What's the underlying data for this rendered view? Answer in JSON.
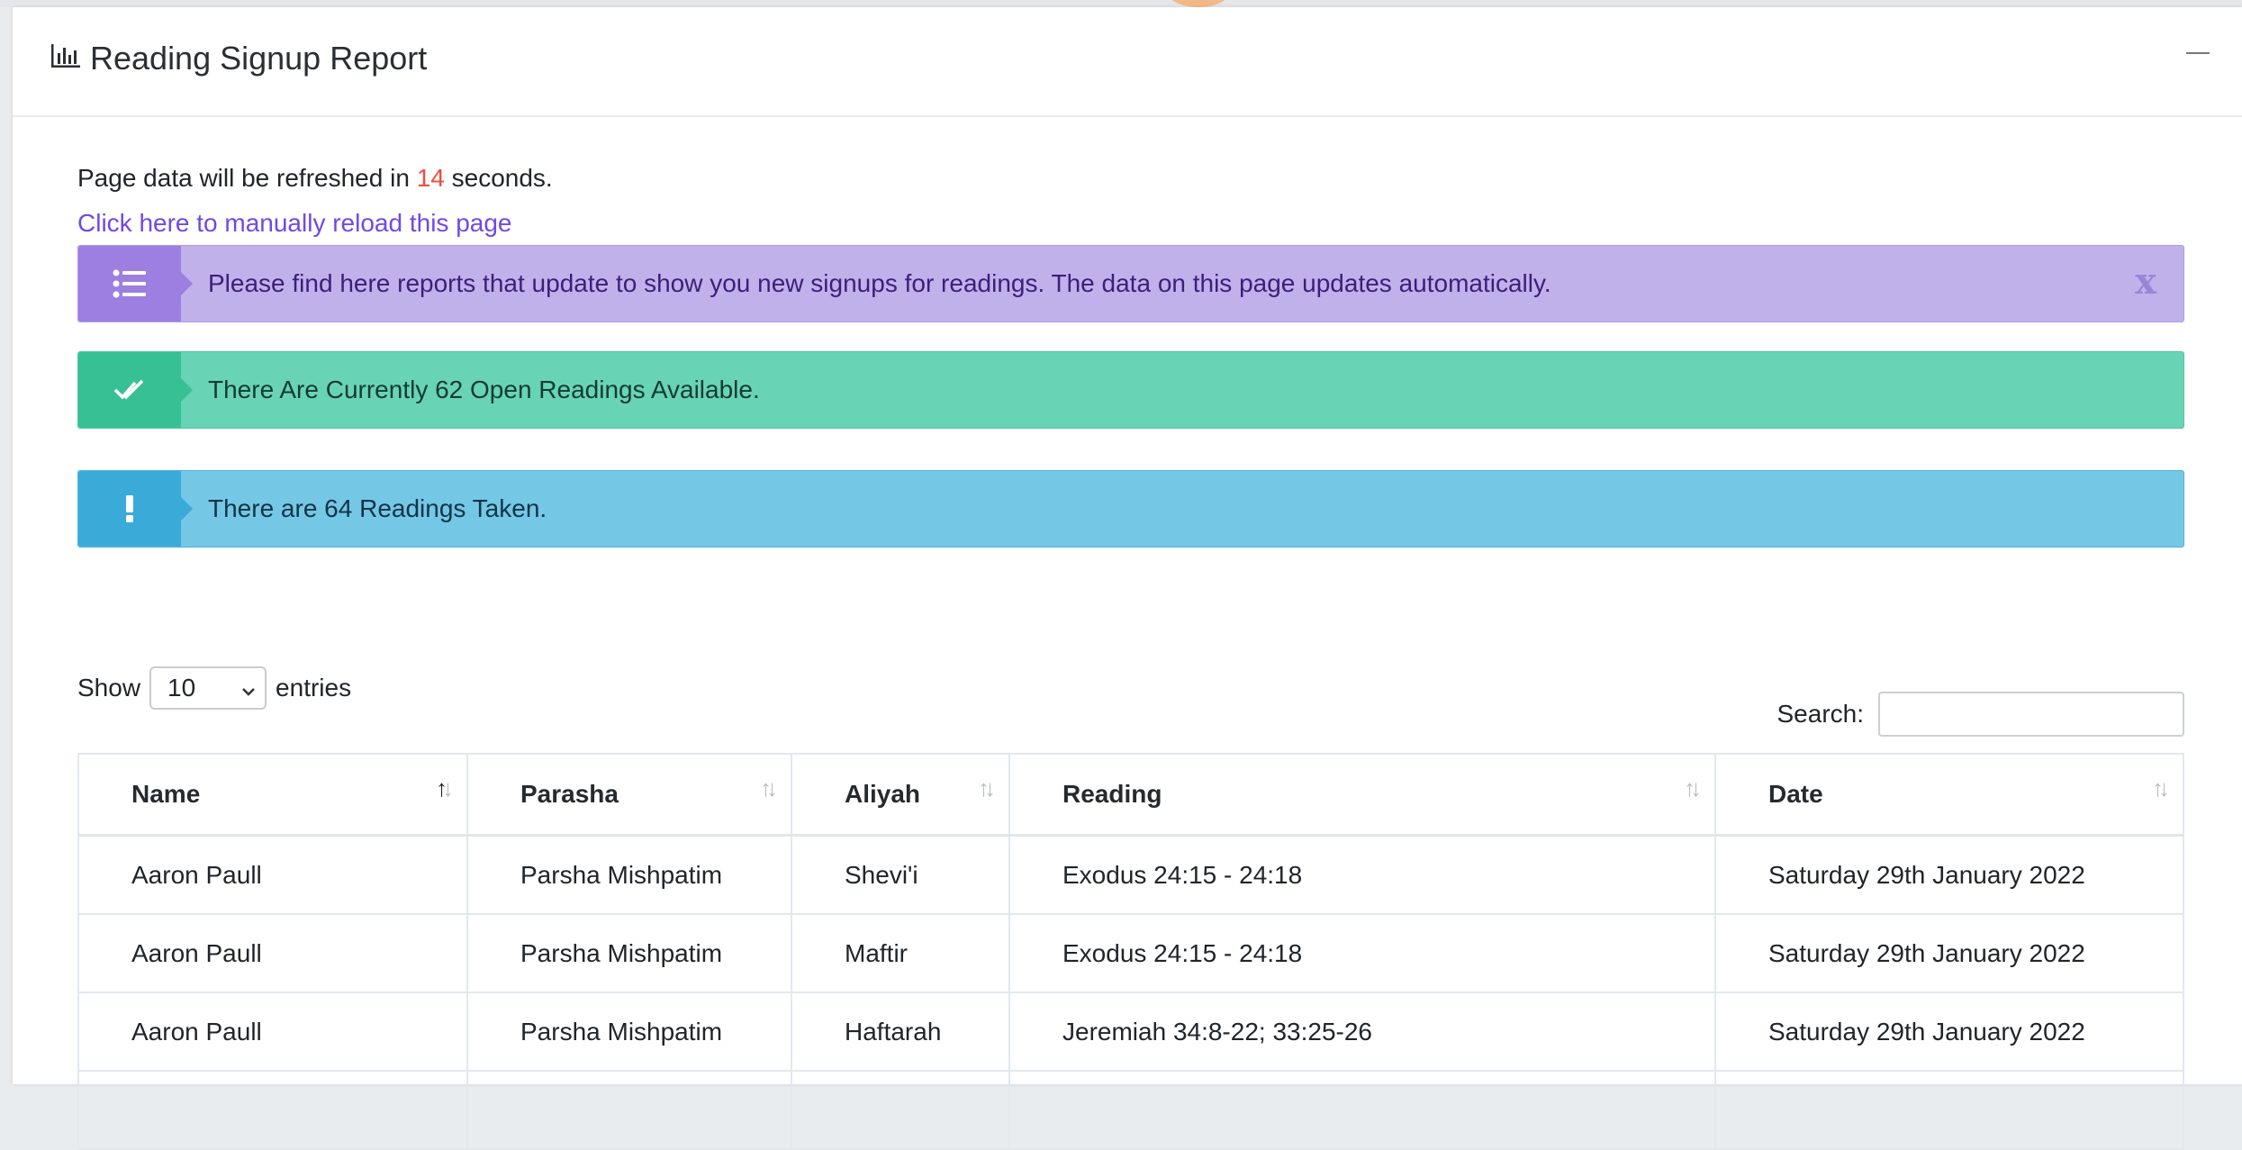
{
  "panel": {
    "title": "Reading Signup Report",
    "chart_icon": "bar-chart-icon",
    "minimize_icon": "minimize-icon"
  },
  "refresh": {
    "prefix": "Page data will be refreshed in",
    "count": "14",
    "suffix": "seconds.",
    "reload_link": "Click here to manually reload this page"
  },
  "alerts": [
    {
      "icon": "list-icon",
      "text": "Please find here reports that update to show you new signups for readings. The data on this page updates automatically.",
      "dismiss": "x",
      "color": "#c1b1eb"
    },
    {
      "icon": "double-check-icon",
      "text": "There Are Currently 62 Open Readings Available.",
      "color": "#69d3b6"
    },
    {
      "icon": "exclamation-icon",
      "text": "There are 64 Readings Taken.",
      "color": "#75c7e6"
    }
  ],
  "length_control": {
    "show": "Show",
    "value": "10",
    "entries": "entries"
  },
  "search": {
    "label": "Search:",
    "value": ""
  },
  "table": {
    "columns": [
      "Name",
      "Parasha",
      "Aliyah",
      "Reading",
      "Date"
    ],
    "rows": [
      [
        "Aaron Paull",
        "Parsha Mishpatim",
        "Shevi'i",
        "Exodus 24:15 - 24:18",
        "Saturday 29th January 2022"
      ],
      [
        "Aaron Paull",
        "Parsha Mishpatim",
        "Maftir",
        "Exodus 24:15 - 24:18",
        "Saturday 29th January 2022"
      ],
      [
        "Aaron Paull",
        "Parsha Mishpatim",
        "Haftarah",
        "Jeremiah 34:8-22; 33:25-26",
        "Saturday 29th January 2022"
      ]
    ]
  }
}
